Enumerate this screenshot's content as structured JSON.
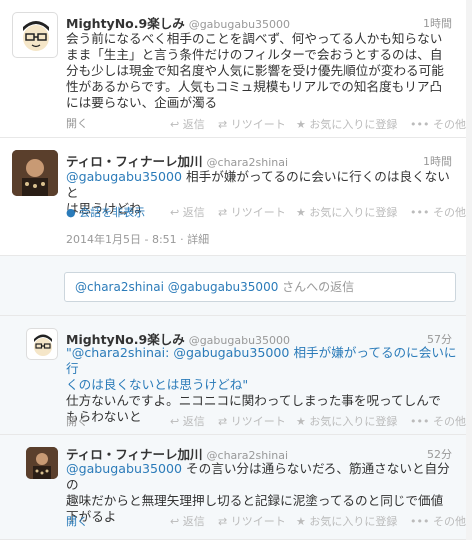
{
  "actions": {
    "reply": "返信",
    "retweet": "リツイート",
    "favorite": "お気に入りに登録",
    "more": "その他"
  },
  "tweets": [
    {
      "name": "MightyNo.9楽しみ",
      "handle": "@gabugabu35000",
      "time": "1時間",
      "lines": [
        "会う前になるべく相手のことを調べず、何やってる人かも知らない",
        "まま「生主」と言う条件だけのフィルターで会おうとするのは、自",
        "分も少しは現金で知名度や人気に影響を受け優先順位が変わる可能",
        "性があるからです。人気もコミュ規模もリアルでの知名度もリア凸",
        "には要らない、企画が濁る"
      ],
      "open_label": "開く"
    },
    {
      "name": "ティロ・フィナーレ加川",
      "handle": "@chara2shinai",
      "time": "1時間",
      "mention": "@gabugabu35000",
      "line1_rest": " 相手が嫌がってるのに会いに行くのは良くないと",
      "line2": "は思うけどね",
      "conversation_label": "会話を非表示",
      "timestamp": "2014年1月5日 - 8:51",
      "detail_label": "詳細"
    },
    {
      "name": "MightyNo.9楽しみ",
      "handle": "@gabugabu35000",
      "time": "57分",
      "quote_line1": "\"@chara2shinai: @gabugabu35000 相手が嫌がってるのに会いに行",
      "quote_line2": "くのは良くないとは思うけどね\"",
      "line3": "仕方ないんですよ。ニコニコに関わってしまった事を呪ってしんで",
      "line4": "もらわないと",
      "open_label": "開く"
    },
    {
      "name": "ティロ・フィナーレ加川",
      "handle": "@chara2shinai",
      "time": "52分",
      "mention": "@gabugabu35000",
      "line1_rest": " その言い分は通らないだろ、筋通さないと自分の",
      "line2": "趣味だからと無理矢理押し切ると記録に泥塗ってるのと同じで価値",
      "line3": "下がるよ",
      "open_label": "開く"
    }
  ],
  "reply_box": {
    "mentions": "@chara2shinai @gabugabu35000",
    "suffix": " さんへの返信"
  },
  "colors": {
    "link": "#2b7bb9",
    "background": "#74b84a"
  }
}
